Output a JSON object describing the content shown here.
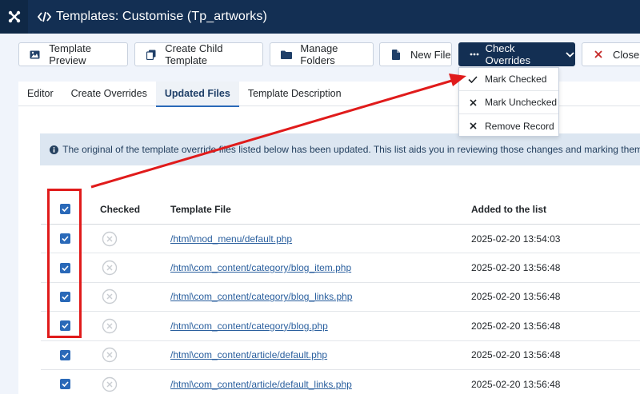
{
  "header": {
    "title": "Templates: Customise (Tp_artworks)"
  },
  "toolbar": {
    "template_preview": "Template Preview",
    "create_child": "Create Child Template",
    "manage_folders": "Manage Folders",
    "new_file": "New File",
    "check_overrides": "Check Overrides",
    "close": "Close"
  },
  "tabs": [
    {
      "label": "Editor"
    },
    {
      "label": "Create Overrides"
    },
    {
      "label": "Updated Files",
      "active": true
    },
    {
      "label": "Template Description"
    }
  ],
  "dropdown": {
    "items": [
      {
        "label": "Mark Checked",
        "icon": "check-icon"
      },
      {
        "label": "Mark Unchecked",
        "icon": "close-icon"
      },
      {
        "label": "Remove Record",
        "icon": "close-icon"
      }
    ]
  },
  "info": {
    "text": "The original of the template override files listed below has been updated. This list aids you in reviewing those changes and marking them as che"
  },
  "table": {
    "headers": {
      "checked": "Checked",
      "file": "Template File",
      "date": "Added to the list"
    },
    "rows": [
      {
        "file": "/html\\mod_menu/default.php",
        "date": "2025-02-20 13:54:03"
      },
      {
        "file": "/html\\com_content/category/blog_item.php",
        "date": "2025-02-20 13:56:48"
      },
      {
        "file": "/html\\com_content/category/blog_links.php",
        "date": "2025-02-20 13:56:48"
      },
      {
        "file": "/html\\com_content/category/blog.php",
        "date": "2025-02-20 13:56:48"
      },
      {
        "file": "/html\\com_content/article/default.php",
        "date": "2025-02-20 13:56:48"
      },
      {
        "file": "/html\\com_content/article/default_links.php",
        "date": "2025-02-20 13:56:48"
      }
    ]
  },
  "colors": {
    "header_bg": "#132f53",
    "accent": "#2a69b8",
    "annotation": "#e01b1b"
  }
}
